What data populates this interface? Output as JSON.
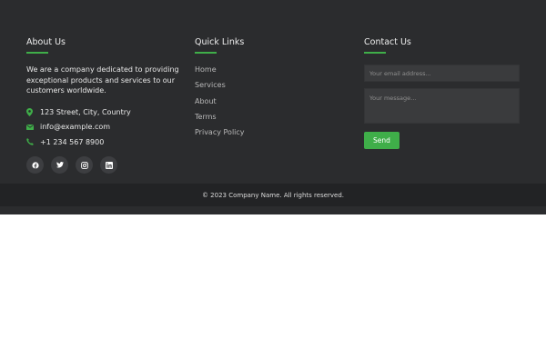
{
  "about": {
    "title": "About Us",
    "text": "We are a company dedicated to providing exceptional products and services to our customers worldwide.",
    "address": "123 Street, City, Country",
    "email": "info@example.com",
    "phone": "+1 234 567 8900",
    "socials": [
      "facebook-icon",
      "twitter-icon",
      "instagram-icon",
      "linkedin-icon"
    ]
  },
  "quick_links": {
    "title": "Quick Links",
    "items": [
      "Home",
      "Services",
      "About",
      "Terms",
      "Privacy Policy"
    ]
  },
  "contact": {
    "title": "Contact Us",
    "email_placeholder": "Your email address...",
    "message_placeholder": "Your message...",
    "send_label": "Send"
  },
  "copyright": "© 2023 Company Name. All rights reserved.",
  "colors": {
    "accent": "#3fae49",
    "footer_bg": "#2b2c2e",
    "bottom_bar_bg": "#222325"
  }
}
